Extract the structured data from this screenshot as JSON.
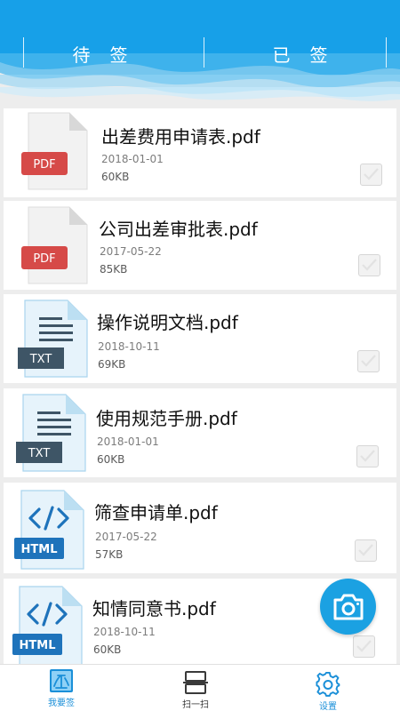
{
  "tabs": [
    {
      "label": "待签"
    },
    {
      "label": "已签"
    }
  ],
  "files": [
    {
      "name": "出差费用申请表.pdf",
      "date": "2018-01-01",
      "size": "60KB",
      "type_label": "PDF",
      "icon": "pdf-file-icon",
      "checked": true
    },
    {
      "name": "公司出差审批表.pdf",
      "date": "2017-05-22",
      "size": "85KB",
      "type_label": "PDF",
      "icon": "pdf-file-icon",
      "checked": true
    },
    {
      "name": "操作说明文档.pdf",
      "date": "2018-10-11",
      "size": "69KB",
      "type_label": "TXT",
      "icon": "txt-file-icon",
      "checked": true
    },
    {
      "name": "使用规范手册.pdf",
      "date": "2018-01-01",
      "size": "60KB",
      "type_label": "TXT",
      "icon": "txt-file-icon",
      "checked": true
    },
    {
      "name": "筛查申请单.pdf",
      "date": "2017-05-22",
      "size": "57KB",
      "type_label": "HTML",
      "icon": "html-file-icon",
      "checked": true
    },
    {
      "name": "知情同意书.pdf",
      "date": "2018-10-11",
      "size": "60KB",
      "type_label": "HTML",
      "icon": "html-file-icon",
      "checked": true
    }
  ],
  "fab": {
    "icon": "camera-icon"
  },
  "bottom_nav": [
    {
      "label": "我要签",
      "icon": "sign-icon",
      "active": true
    },
    {
      "label": "扫一扫",
      "icon": "scan-icon",
      "active": false
    },
    {
      "label": "设置",
      "icon": "gear-icon",
      "active": false
    }
  ],
  "colors": {
    "accent": "#1ba1e2",
    "header_dark": "#1a96e4",
    "pdf_badge": "#d64a48",
    "txt_badge": "#3e5566",
    "html_badge": "#1e73bb",
    "nav_active": "#1a8fd8",
    "nav_inactive": "#3a3a3a"
  }
}
